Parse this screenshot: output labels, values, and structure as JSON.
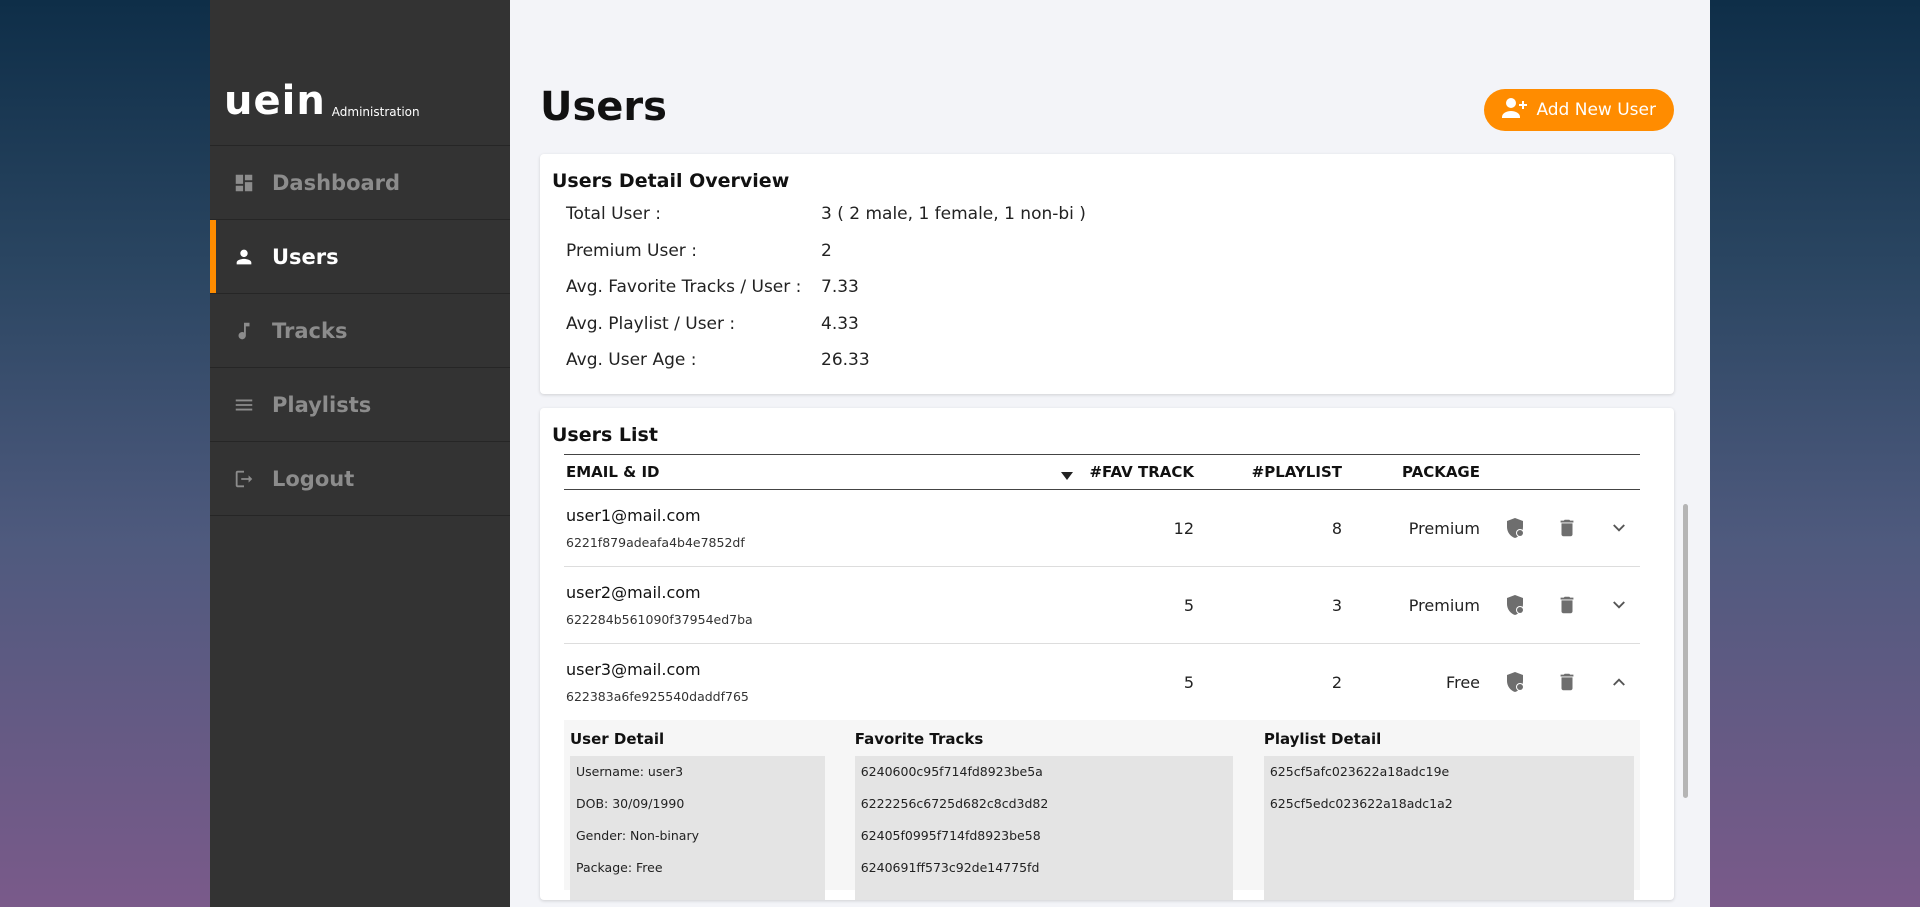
{
  "sidebar": {
    "logo": "uein",
    "logo_sub": "Administration",
    "items": [
      {
        "label": "Dashboard",
        "icon": "dashboard-icon"
      },
      {
        "label": "Users",
        "icon": "user-icon",
        "active": true
      },
      {
        "label": "Tracks",
        "icon": "music-note-icon"
      },
      {
        "label": "Playlists",
        "icon": "list-icon"
      },
      {
        "label": "Logout",
        "icon": "logout-icon"
      }
    ]
  },
  "header": {
    "title": "Users",
    "add_button": "Add New User"
  },
  "overview": {
    "title": "Users Detail Overview",
    "rows": [
      {
        "label": "Total User :",
        "value": "3 ( 2 male, 1 female, 1 non-bi )"
      },
      {
        "label": "Premium User :",
        "value": "2"
      },
      {
        "label": "Avg. Favorite Tracks / User :",
        "value": "7.33"
      },
      {
        "label": "Avg. Playlist / User :",
        "value": "4.33"
      },
      {
        "label": "Avg. User Age :",
        "value": "26.33"
      }
    ]
  },
  "users_list": {
    "title": "Users List",
    "columns": [
      "EMAIL & ID",
      "#FAV TRACK",
      "#PLAYLIST",
      "PACKAGE"
    ],
    "rows": [
      {
        "email": "user1@mail.com",
        "id": "6221f879adeafa4b4e7852df",
        "fav": "12",
        "playlist": "8",
        "package": "Premium"
      },
      {
        "email": "user2@mail.com",
        "id": "622284b561090f37954ed7ba",
        "fav": "5",
        "playlist": "3",
        "package": "Premium"
      },
      {
        "email": "user3@mail.com",
        "id": "622383a6fe925540daddf765",
        "fav": "5",
        "playlist": "2",
        "package": "Free"
      }
    ],
    "expanded": {
      "user_detail_title": "User Detail",
      "user_detail": [
        "Username: user3",
        "DOB: 30/09/1990",
        "Gender: Non-binary",
        "Package: Free"
      ],
      "fav_title": "Favorite Tracks",
      "fav_tracks": [
        "6240600c95f714fd8923be5a",
        "6222256c6725d682c8cd3d82",
        "62405f0995f714fd8923be58",
        "6240691ff573c92de14775fd"
      ],
      "playlist_title": "Playlist Detail",
      "playlists": [
        "625cf5afc023622a18adc19e",
        "625cf5edc023622a18adc1a2"
      ]
    }
  },
  "colors": {
    "accent": "#ff8c00",
    "sidebar_bg": "#333333"
  }
}
